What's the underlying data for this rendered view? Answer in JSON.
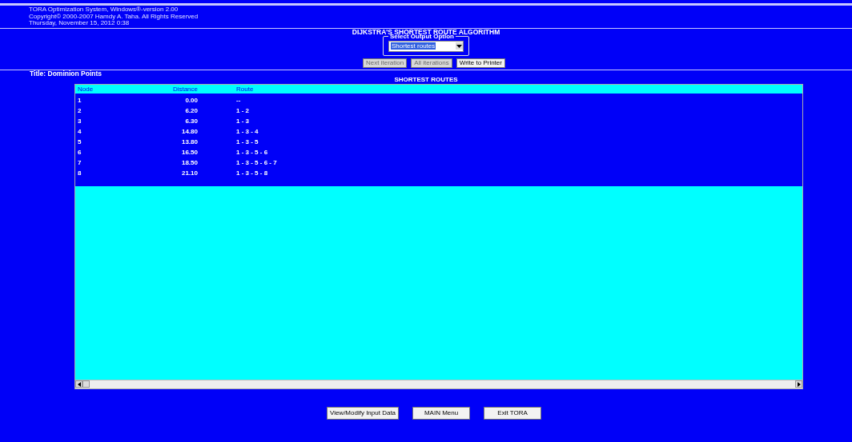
{
  "header_lines": [
    "TORA Optimization System, Windows®-version 2.00",
    "Copyright© 2000-2007 Hamdy A. Taha. All Rights Reserved",
    "Thursday, November 15, 2012 0:38"
  ],
  "page_title": "DIJKSTRA'S SHORTEST ROUTE ALGORITHM",
  "output_option": {
    "legend": "Select Output Option",
    "value": "Shortest routes"
  },
  "actions": [
    {
      "label": "Next iteration",
      "disabled": true
    },
    {
      "label": "All iterations",
      "disabled": true
    },
    {
      "label": "Write to Printer",
      "disabled": false
    }
  ],
  "problem_title": "Title: Dominion Points",
  "section_title": "SHORTEST ROUTES",
  "table": {
    "columns": [
      "Node",
      "Distance",
      "Route"
    ],
    "rows": [
      [
        "1",
        "0.00",
        "--"
      ],
      [
        "2",
        "6.20",
        "1 - 2"
      ],
      [
        "3",
        "6.30",
        "1 - 3"
      ],
      [
        "4",
        "14.80",
        "1 - 3 - 4"
      ],
      [
        "5",
        "13.80",
        "1 - 3 - 5"
      ],
      [
        "6",
        "16.50",
        "1 - 3 - 5 - 6"
      ],
      [
        "7",
        "18.50",
        "1 - 3 - 5 - 6 - 7"
      ],
      [
        "8",
        "21.10",
        "1 - 3 - 5 - 8"
      ]
    ]
  },
  "footer_buttons": [
    "View/Modify Input Data",
    "MAIN Menu",
    "Exit TORA"
  ]
}
